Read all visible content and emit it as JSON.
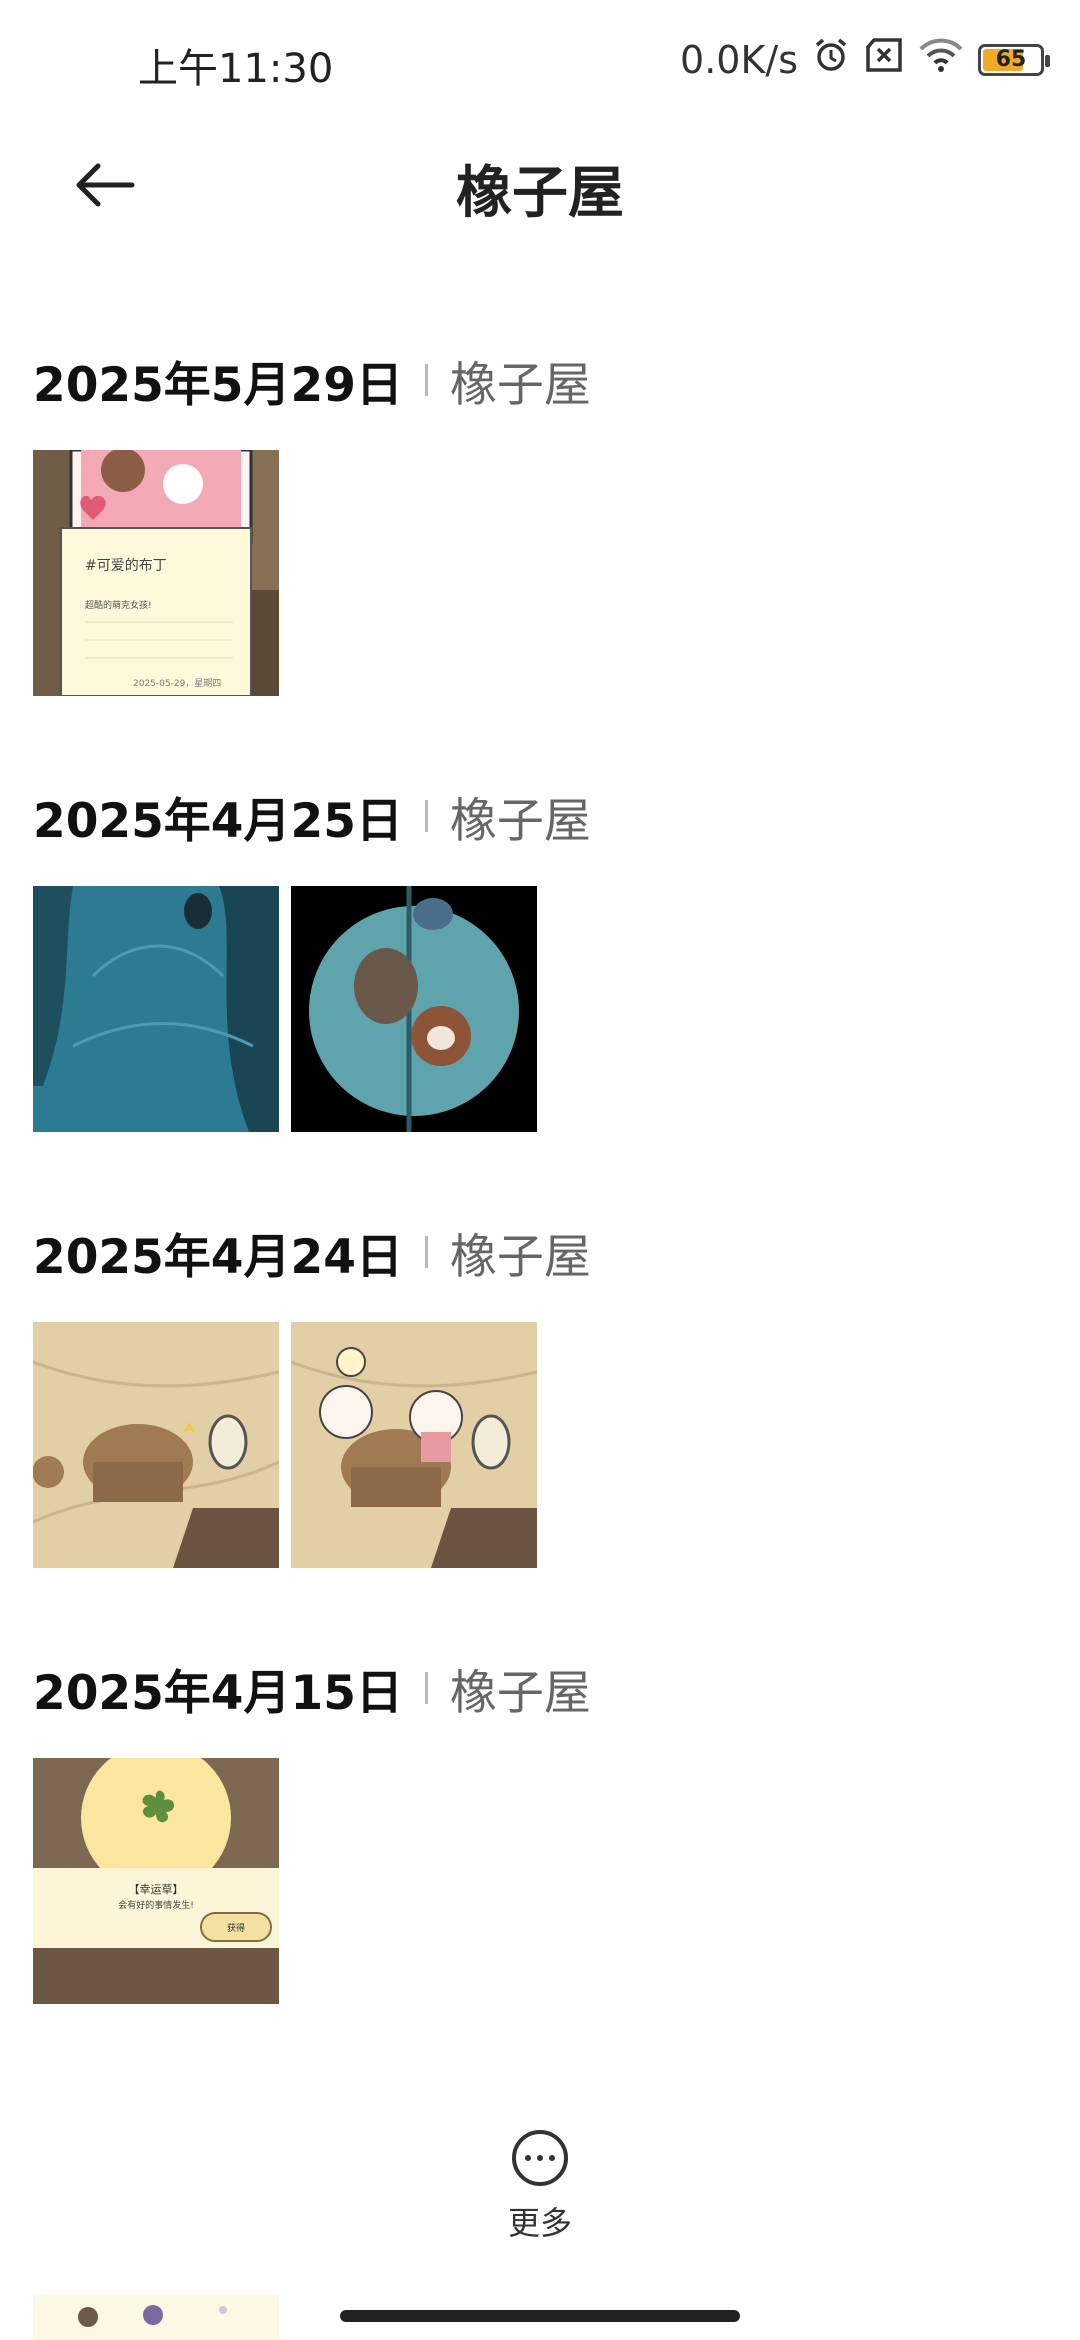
{
  "status": {
    "time": "上午11:30",
    "network_speed": "0.0K/s",
    "battery": "65"
  },
  "appbar": {
    "title": "橡子屋"
  },
  "groups": [
    {
      "date": "2025年5月29日",
      "source": "橡子屋",
      "images": 1,
      "note": {
        "tag": "#可爱的布丁",
        "line": "超酷的萌克女孩!",
        "stamp": "2025-05-29，星期四"
      }
    },
    {
      "date": "2025年4月25日",
      "source": "橡子屋",
      "images": 2
    },
    {
      "date": "2025年4月24日",
      "source": "橡子屋",
      "images": 2
    },
    {
      "date": "2025年4月15日",
      "source": "橡子屋",
      "images": 1,
      "card": {
        "title": "【幸运草】",
        "text": "会有好的事情发生!",
        "button": "获得"
      }
    }
  ],
  "more": {
    "label": "更多"
  }
}
